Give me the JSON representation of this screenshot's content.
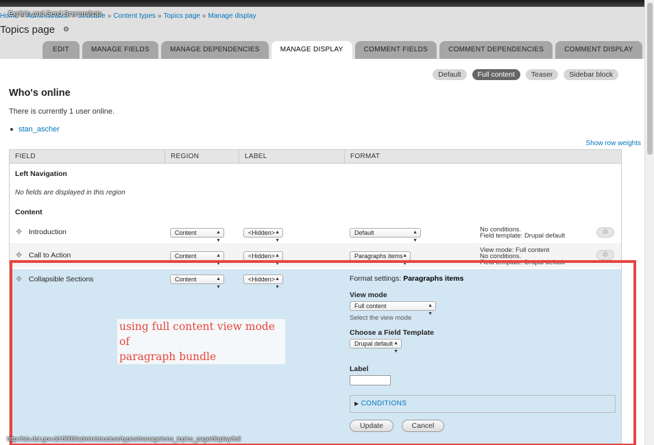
{
  "window_title": "Explain and Send Screenshots",
  "breadcrumb": [
    "Home",
    "Administration",
    "Structure",
    "Content types",
    "Topics page",
    "Manage display"
  ],
  "page_title": "Topics page",
  "tabs": [
    "EDIT",
    "MANAGE FIELDS",
    "MANAGE DEPENDENCIES",
    "MANAGE DISPLAY",
    "COMMENT FIELDS",
    "COMMENT DEPENDENCIES",
    "COMMENT DISPLAY"
  ],
  "active_tab": "MANAGE DISPLAY",
  "view_modes": [
    "Default",
    "Full content",
    "Teaser",
    "Sidebar block"
  ],
  "active_view_mode": "Full content",
  "block": {
    "title": "Who's online",
    "text": "There is currently 1 user online.",
    "users": [
      "stan_ascher"
    ]
  },
  "show_row_weights": "Show row weights",
  "table": {
    "headers": [
      "FIELD",
      "REGION",
      "LABEL",
      "FORMAT"
    ],
    "regions": {
      "left_navigation": "Left Navigation",
      "left_navigation_empty": "No fields are displayed in this region",
      "content": "Content"
    },
    "rows": [
      {
        "field": "Introduction",
        "region": "Content",
        "label": "<Hidden>",
        "format": "Default",
        "summary": [
          "No conditions.",
          "Field template: Drupal default"
        ]
      },
      {
        "field": "Call to Action",
        "region": "Content",
        "label": "<Hidden>",
        "format": "Paragraphs items",
        "summary": [
          "View mode: Full content",
          "No conditions.",
          "Field template: Drupal default"
        ]
      },
      {
        "field": "Collapsible Sections",
        "region": "Content",
        "label": "<Hidden>"
      }
    ]
  },
  "format_settings": {
    "title_prefix": "Format settings:",
    "title_value": "Paragraphs items",
    "view_mode_label": "View mode",
    "view_mode_value": "Full content",
    "view_mode_desc": "Select the view mode",
    "field_template_label": "Choose a Field Template",
    "field_template_value": "Drupal default",
    "label_label": "Label",
    "label_value": "",
    "conditions": "CONDITIONS",
    "update": "Update",
    "cancel": "Cancel"
  },
  "annotation": {
    "line1": "using full content view mode of",
    "line2": "paragraph bundle",
    "color": "#e8453c"
  },
  "status_url": "http://sts.dot.gov.dd:8083/admin/structure/types/manage/cms_topics_page/display/full",
  "icons": {
    "gear": "gear-icon",
    "drag": "drag-handle-icon",
    "select_arrow": "updown-arrows-icon",
    "disclosure": "triangle-right-icon"
  }
}
